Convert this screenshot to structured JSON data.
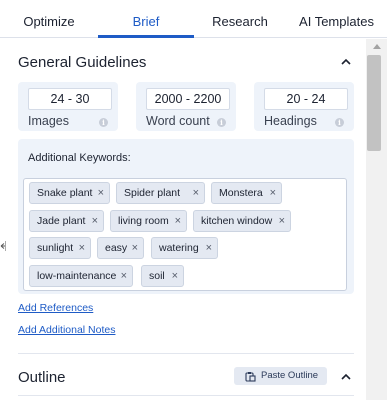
{
  "tabs": [
    {
      "label": "Optimize",
      "active": false
    },
    {
      "label": "Brief",
      "active": true
    },
    {
      "label": "Research",
      "active": false
    },
    {
      "label": "AI Templates",
      "active": false
    }
  ],
  "general_guidelines": {
    "title": "General Guidelines",
    "metrics": [
      {
        "value": "24 - 30",
        "label": "Images"
      },
      {
        "value": "2000 - 2200",
        "label": "Word count"
      },
      {
        "value": "20 - 24",
        "label": "Headings"
      }
    ],
    "info_icon": "i",
    "keywords_title": "Additional Keywords:",
    "keywords": [
      "Snake plant",
      "Spider plant",
      "Monstera",
      "Jade plant",
      "living room",
      "kitchen window",
      "sunlight",
      "easy",
      "watering",
      "low-maintenance",
      "soil"
    ],
    "remove_glyph": "×"
  },
  "links": {
    "add_references": "Add References",
    "add_notes": "Add Additional Notes"
  },
  "outline": {
    "title": "Outline",
    "paste_label": "Paste Outline"
  },
  "colors": {
    "accent": "#1e5bc6",
    "card_bg": "#eef3fa",
    "chip_bg": "#e4e9f2"
  }
}
